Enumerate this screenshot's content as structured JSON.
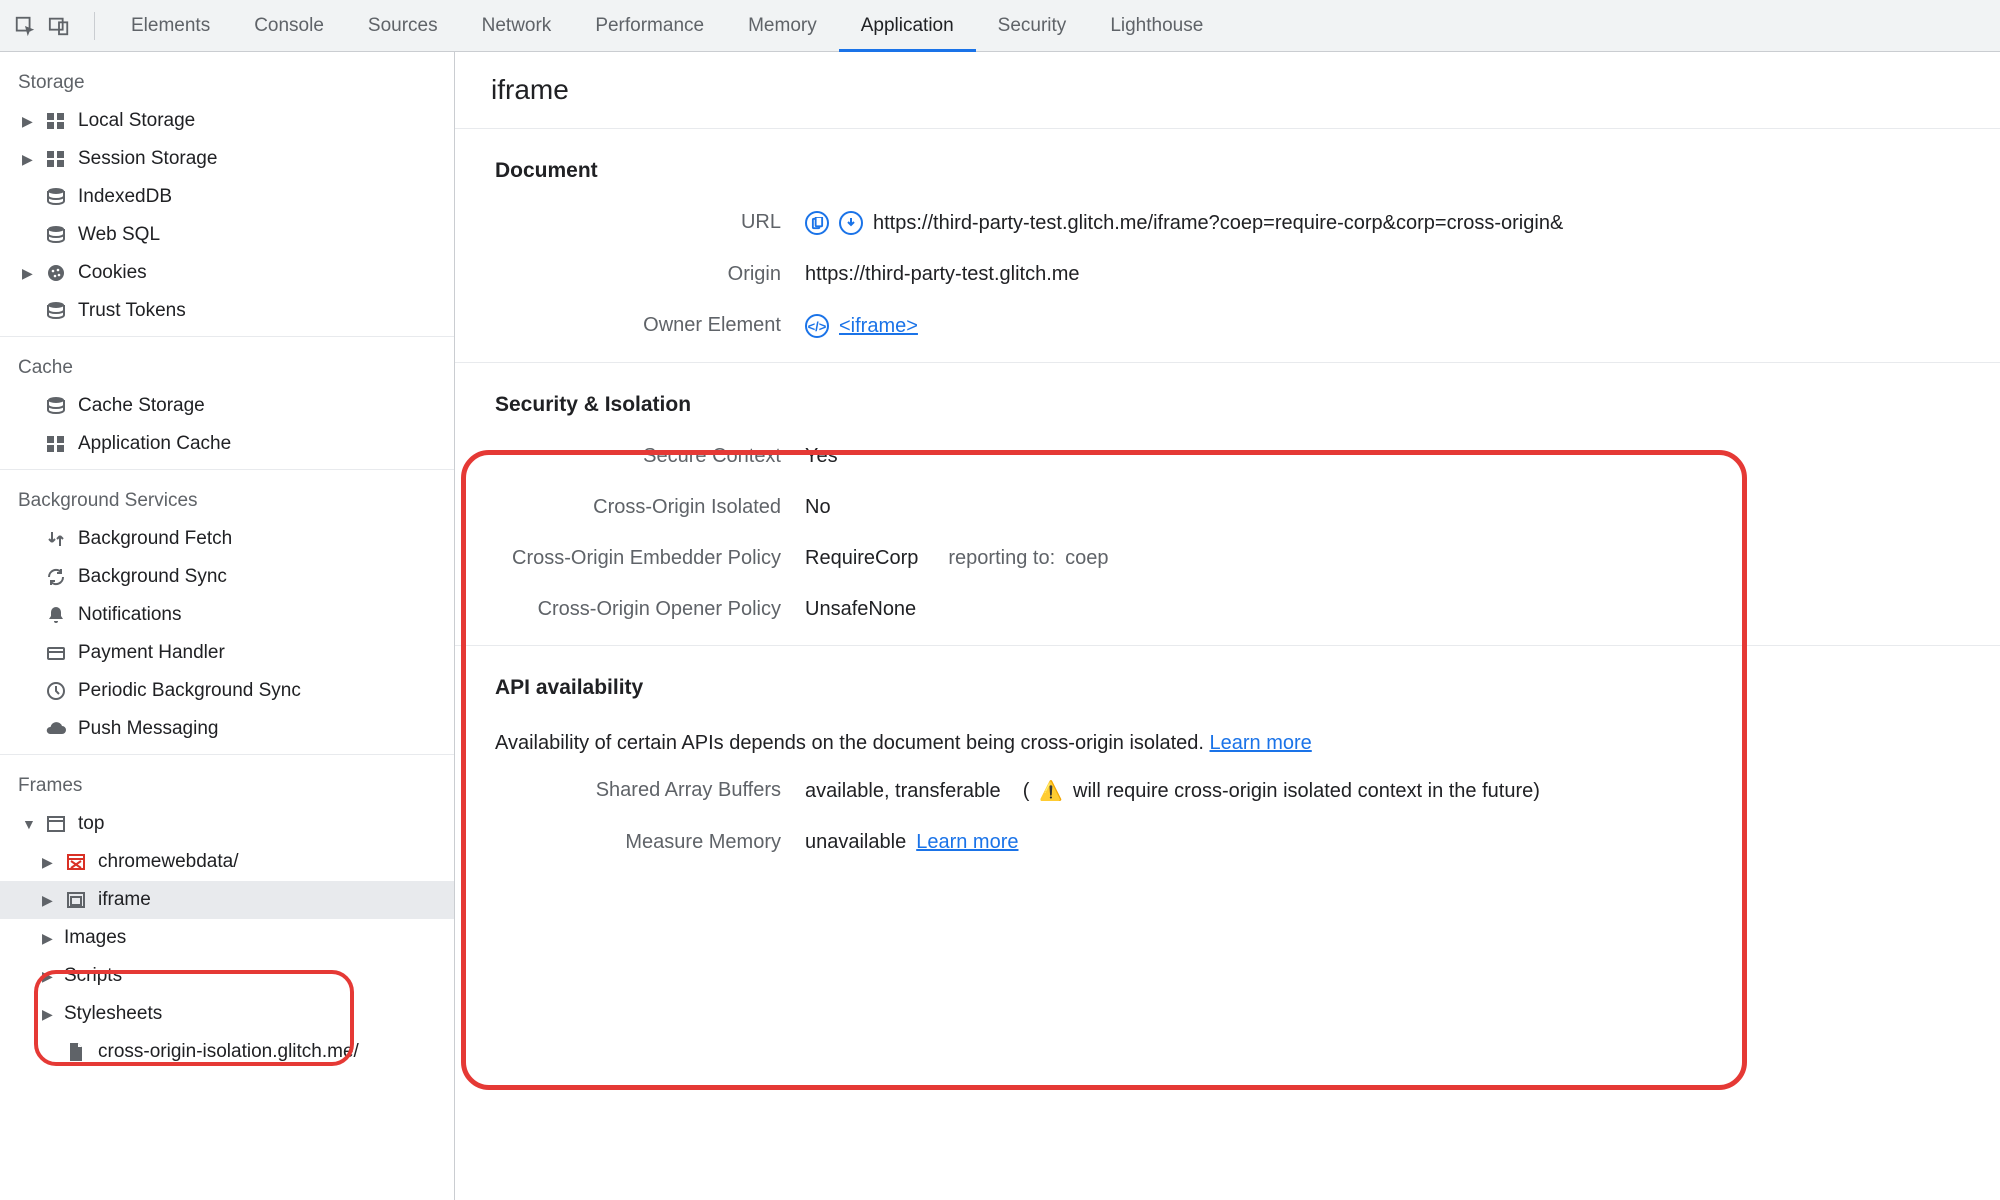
{
  "tabs": {
    "elements": "Elements",
    "console": "Console",
    "sources": "Sources",
    "network": "Network",
    "performance": "Performance",
    "memory": "Memory",
    "application": "Application",
    "security": "Security",
    "lighthouse": "Lighthouse"
  },
  "sidebar": {
    "storage": {
      "title": "Storage",
      "local": "Local Storage",
      "session": "Session Storage",
      "indexeddb": "IndexedDB",
      "websql": "Web SQL",
      "cookies": "Cookies",
      "trust": "Trust Tokens"
    },
    "cache": {
      "title": "Cache",
      "cachestorage": "Cache Storage",
      "appcache": "Application Cache"
    },
    "bg": {
      "title": "Background Services",
      "fetch": "Background Fetch",
      "sync": "Background Sync",
      "notif": "Notifications",
      "payment": "Payment Handler",
      "periodic": "Periodic Background Sync",
      "push": "Push Messaging"
    },
    "frames": {
      "title": "Frames",
      "top": "top",
      "chromewebdata": "chromewebdata/",
      "iframe": "iframe",
      "images": "Images",
      "scripts": "Scripts",
      "stylesheets": "Stylesheets",
      "coiso": "cross-origin-isolation.glitch.me/"
    }
  },
  "content": {
    "title": "iframe",
    "document": {
      "head": "Document",
      "url_label": "URL",
      "url": "https://third-party-test.glitch.me/iframe?coep=require-corp&corp=cross-origin&",
      "origin_label": "Origin",
      "origin": "https://third-party-test.glitch.me",
      "owner_label": "Owner Element",
      "owner_link": "<iframe>"
    },
    "security": {
      "head": "Security & Isolation",
      "secure_label": "Secure Context",
      "secure_val": "Yes",
      "coi_label": "Cross-Origin Isolated",
      "coi_val": "No",
      "coep_label": "Cross-Origin Embedder Policy",
      "coep_val": "RequireCorp",
      "coep_reporting_label": "reporting to:",
      "coep_reporting_val": "coep",
      "coop_label": "Cross-Origin Opener Policy",
      "coop_val": "UnsafeNone"
    },
    "api": {
      "head": "API availability",
      "desc": "Availability of certain APIs depends on the document being cross-origin isolated.",
      "learn": "Learn more",
      "sab_label": "Shared Array Buffers",
      "sab_val": "available, transferable",
      "sab_note_open": "(",
      "sab_note": "will require cross-origin isolated context in the future)",
      "mem_label": "Measure Memory",
      "mem_val": "unavailable",
      "mem_learn": "Learn more"
    }
  }
}
